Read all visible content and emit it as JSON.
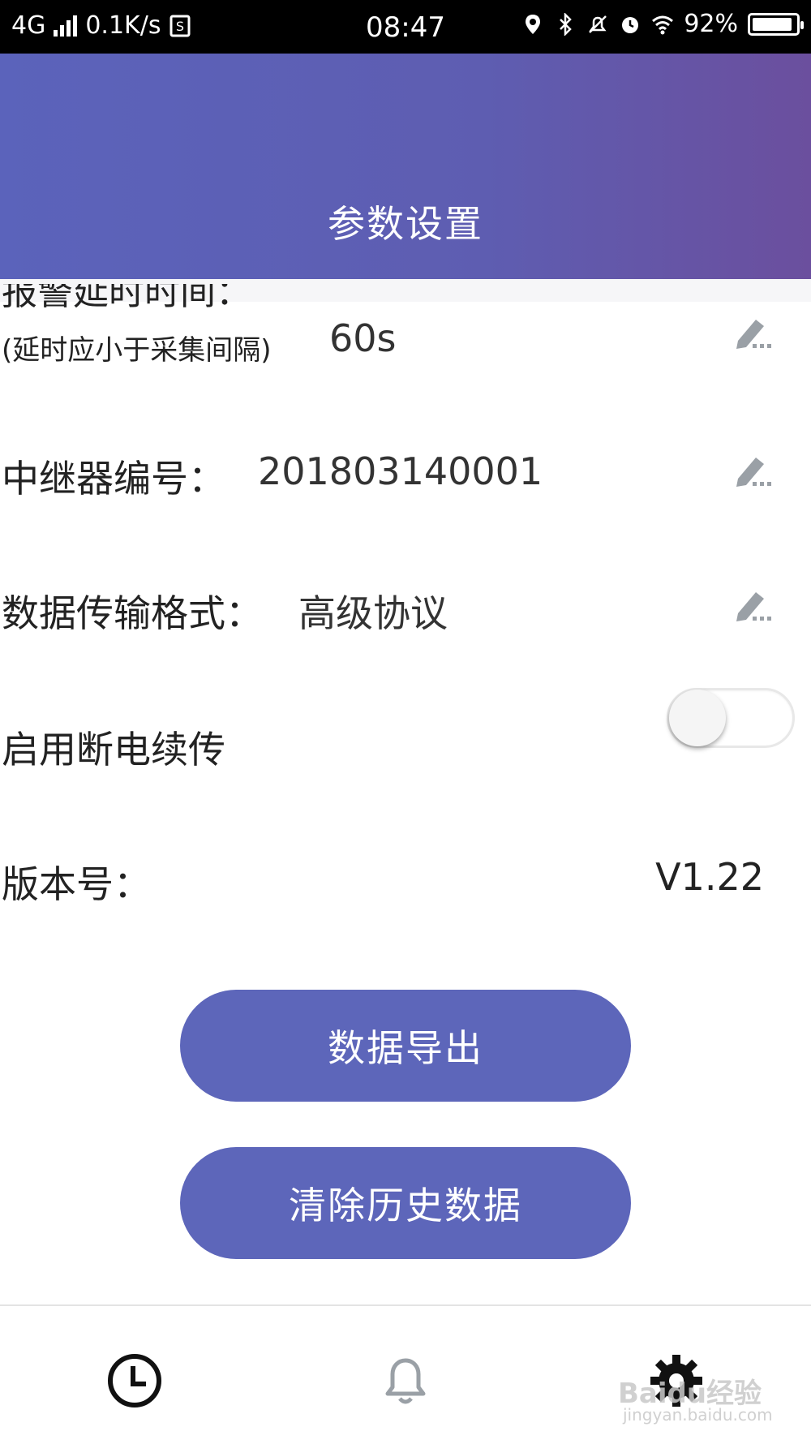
{
  "status_bar": {
    "network": "4G",
    "speed": "0.1K/s",
    "time": "08:47",
    "battery": "92%",
    "battery_level": 0.92
  },
  "header": {
    "title": "参数设置"
  },
  "rows": {
    "alarm_delay": {
      "label_cut": "报警延时时间：",
      "note": "(延时应小于采集间隔)",
      "value": "60s"
    },
    "relay_id": {
      "label": "中继器编号：",
      "value": "201803140001"
    },
    "transfer_format": {
      "label": "数据传输格式：",
      "value": "高级协议"
    },
    "power_resume": {
      "label": "启用断电续传",
      "enabled": false
    },
    "version": {
      "label": "版本号：",
      "value": "V1.22"
    }
  },
  "buttons": {
    "export": "数据导出",
    "clear_history": "清除历史数据"
  },
  "watermark": {
    "brand": "Baidu经验",
    "url": "jingyan.baidu.com"
  },
  "icons": {
    "nav_history": "clock-icon",
    "nav_alerts": "bell-icon",
    "nav_settings": "gear-icon",
    "edit": "pencil-icon"
  }
}
